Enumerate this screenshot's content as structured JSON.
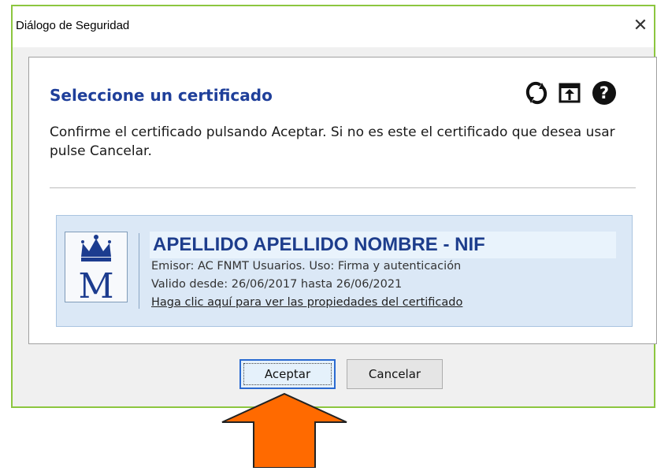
{
  "window": {
    "title": "Diálogo de Seguridad",
    "close_glyph": "✕"
  },
  "panel": {
    "heading": "Seleccione un certificado",
    "description": "Confirme el certificado pulsando Aceptar. Si no es este el certificado que desea usar pulse Cancelar.",
    "toolbar_icons": [
      "refresh-icon",
      "open-file-icon",
      "help-icon"
    ]
  },
  "certificate": {
    "name": "APELLIDO APELLIDO NOMBRE - NIF",
    "issuer": "Emisor: AC FNMT Usuarios. Uso: Firma y autenticación",
    "validity": "Valido desde: 26/06/2017 hasta 26/06/2021",
    "link": "Haga clic aquí para ver las propiedades del certificado",
    "logo_letter": "M",
    "logo_icon": "crown-m-logo"
  },
  "buttons": {
    "accept": "Aceptar",
    "cancel": "Cancelar"
  },
  "colors": {
    "heading": "#1f3f9a",
    "cert_background": "#dbe8f6",
    "cert_name": "#1d3d8c",
    "arrow": "#ff6a00",
    "dialog_border": "#8cc63f"
  },
  "annotation": {
    "icon": "up-arrow-pointer"
  }
}
